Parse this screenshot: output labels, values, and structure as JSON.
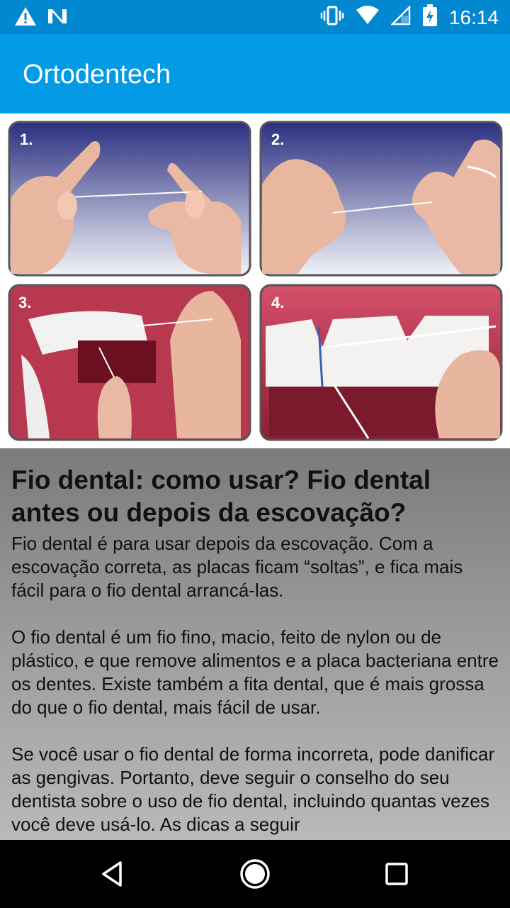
{
  "status_bar": {
    "time": "16:14",
    "icons_left": [
      "warning-icon",
      "n-notification-icon"
    ],
    "icons_right": [
      "vibrate-icon",
      "wifi-icon",
      "no-signal-icon",
      "battery-charging-icon"
    ]
  },
  "app_bar": {
    "title": "Ortodentech",
    "color": "#039be5"
  },
  "illustration": {
    "panels": [
      "1.",
      "2.",
      "3.",
      "4."
    ]
  },
  "article": {
    "heading": "Fio dental: como usar? Fio dental antes ou depois da escovação?",
    "paragraphs": [
      "Fio dental é para usar depois da escovação. Com a escovação correta, as placas ficam “soltas”, e fica mais fácil para o fio dental arrancá-las.",
      "O fio dental é um fio fino, macio, feito de nylon ou de plástico, e que remove alimentos e a placa bacteriana entre os dentes. Existe também a fita dental, que é mais grossa do que o fio dental, mais fácil de usar.",
      "Se você usar o fio dental de forma incorreta, pode danificar as gengivas. Portanto, deve seguir o conselho do seu dentista sobre o uso de fio dental, incluindo quantas vezes você deve usá-lo. As dicas a seguir"
    ]
  },
  "nav_bar": {
    "buttons": [
      "back-icon",
      "home-icon",
      "recents-icon"
    ]
  }
}
